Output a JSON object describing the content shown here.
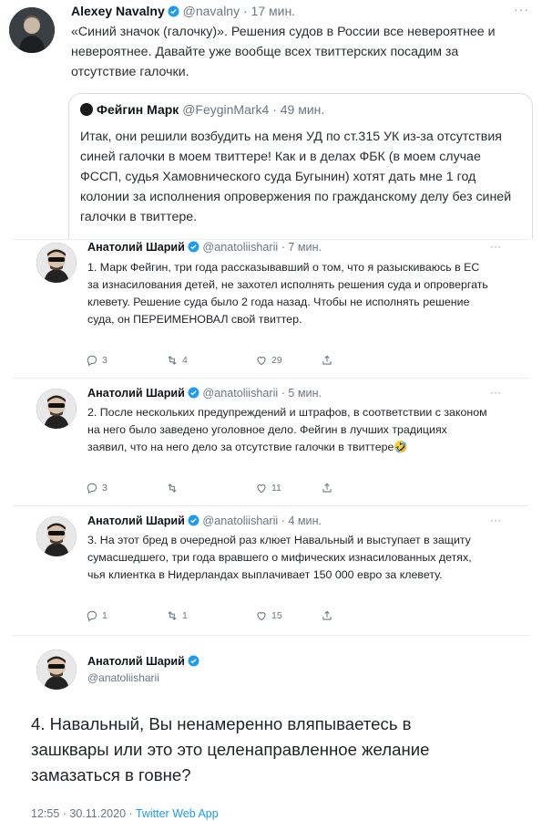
{
  "top_tweet": {
    "name": "Alexey Navalny",
    "handle_time": "@navalny · 17 мин.",
    "more": "···",
    "text": "«Синий значок (галочку)». Решения судов в России все невероятнее и невероятнее. Давайте уже вообще всех твиттерских посадим за отсутствие галочки.",
    "quote": {
      "name": "Фейгин Марк",
      "handle_time": "@FeyginMark4 · 49 мин.",
      "text": "Итак, они решили возбудить на меня УД по ст.315 УК из-за отсутствия синей галочки в моем твиттере! Как и в делах ФБК (в моем случае ФССП, судья Хамовнического суда Бугынин) хотят дать мне 1 год колонии за исполнения опровержения по гражданскому делу без синей галочки в твиттере."
    }
  },
  "thread": [
    {
      "name": "Анатолий Шарий",
      "handle_time": "@anatoliisharii · 7 мин.",
      "more": "···",
      "text": "1. Марк Фейгин, три года рассказывавший о том, что я разыскиваюсь в ЕС за изнасилования детей, не захотел исполнять решения суда и опровергать клевету. Решение суда было 2 года назад. Чтобы не исполнять решение суда, он ПЕРЕИМЕНОВАЛ свой твиттер.",
      "replies": "3",
      "retweets": "4",
      "likes": "29"
    },
    {
      "name": "Анатолий Шарий",
      "handle_time": "@anatoliisharii · 5 мин.",
      "more": "···",
      "text": "2. После нескольких предупреждений и штрафов, в соответствии с законом на него было заведено уголовное дело. Фейгин в лучших традициях заявил, что на него дело за отсутствие галочки в твиттере",
      "emoji": "🤣",
      "replies": "3",
      "retweets": "",
      "likes": "11"
    },
    {
      "name": "Анатолий Шарий",
      "handle_time": "@anatoliisharii · 4 мин.",
      "more": "···",
      "text": "3. На этот бред в очередной раз клюет Навальный и выступает в защиту сумасшедшего, три года вравшего о мифических изнасилованных детях, чья клиентка в Нидерландах выплачивает 150 000 евро за клевету.",
      "replies": "1",
      "retweets": "1",
      "likes": "15"
    }
  ],
  "final_tweet": {
    "name": "Анатолий Шарий",
    "handle": "@anatoliisharii",
    "text": "4. Навальный, Вы ненамеренно вляпываетесь в зашквары или это это целенаправленное желание замазаться в говне?",
    "time": "12:55 · 30.11.2020 · ",
    "app": "Twitter Web App"
  },
  "colors": {
    "accent": "#1d9bf0",
    "muted": "#6b7780",
    "text": "#0f1419"
  }
}
